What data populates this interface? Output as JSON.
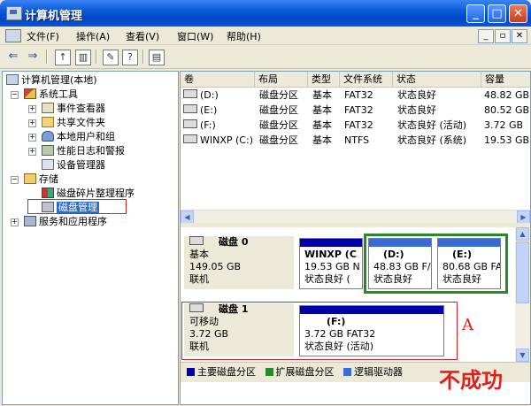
{
  "window": {
    "title": "计算机管理",
    "min_glyph": "_",
    "max_glyph": "□",
    "close_glyph": "✕"
  },
  "menu": [
    "文件(F)",
    "操作(A)",
    "查看(V)",
    "窗口(W)",
    "帮助(H)"
  ],
  "mdi_buttons": [
    "_",
    "▫",
    "✕"
  ],
  "tree": [
    {
      "label": "计算机管理(本地)",
      "icon": "computer-icon"
    },
    {
      "label": "系统工具",
      "icon": "tools-icon"
    },
    {
      "label": "事件查看器",
      "icon": "event-viewer-icon"
    },
    {
      "label": "共享文件夹",
      "icon": "shared-folder-icon"
    },
    {
      "label": "本地用户和组",
      "icon": "users-icon"
    },
    {
      "label": "性能日志和警报",
      "icon": "performance-icon"
    },
    {
      "label": "设备管理器",
      "icon": "device-manager-icon"
    },
    {
      "label": "存储",
      "icon": "storage-icon"
    },
    {
      "label": "磁盘碎片整理程序",
      "icon": "defrag-icon"
    },
    {
      "label": "磁盘管理",
      "icon": "disk-management-icon"
    },
    {
      "label": "服务和应用程序",
      "icon": "services-icon"
    }
  ],
  "columns": [
    "卷",
    "布局",
    "类型",
    "文件系统",
    "状态",
    "容量"
  ],
  "volumes": [
    {
      "vol": "(D:)",
      "layout": "磁盘分区",
      "type": "基本",
      "fs": "FAT32",
      "status": "状态良好",
      "cap": "48.82 GB"
    },
    {
      "vol": "(E:)",
      "layout": "磁盘分区",
      "type": "基本",
      "fs": "FAT32",
      "status": "状态良好",
      "cap": "80.52 GB"
    },
    {
      "vol": "(F:)",
      "layout": "磁盘分区",
      "type": "基本",
      "fs": "FAT32",
      "status": "状态良好 (活动)",
      "cap": "3.72 GB"
    },
    {
      "vol": "WINXP (C:)",
      "layout": "磁盘分区",
      "type": "基本",
      "fs": "NTFS",
      "status": "状态良好 (系统)",
      "cap": "19.53 GB"
    }
  ],
  "disk0": {
    "name": "磁盘 0",
    "type": "基本",
    "size": "149.05 GB",
    "state": "联机",
    "parts": [
      {
        "title": "WINXP (C",
        "line1": "19.53 GB N",
        "line2": "状态良好 ("
      },
      {
        "title": "(D:)",
        "line1": "48.83 GB F/",
        "line2": "状态良好"
      },
      {
        "title": "(E:)",
        "line1": "80.68 GB FA",
        "line2": "状态良好"
      }
    ]
  },
  "disk1": {
    "name": "磁盘 1",
    "type": "可移动",
    "size": "3.72 GB",
    "state": "联机",
    "part": {
      "title": "(F:)",
      "line1": "3.72 GB FAT32",
      "line2": "状态良好 (活动)"
    }
  },
  "legend": [
    {
      "label": "主要磁盘分区",
      "color": "#0000a8"
    },
    {
      "label": "扩展磁盘分区",
      "color": "#2a8a2a"
    },
    {
      "label": "逻辑驱动器",
      "color": "#3a6bd4"
    }
  ],
  "annotations": {
    "a": "A",
    "fail": "不成功"
  }
}
